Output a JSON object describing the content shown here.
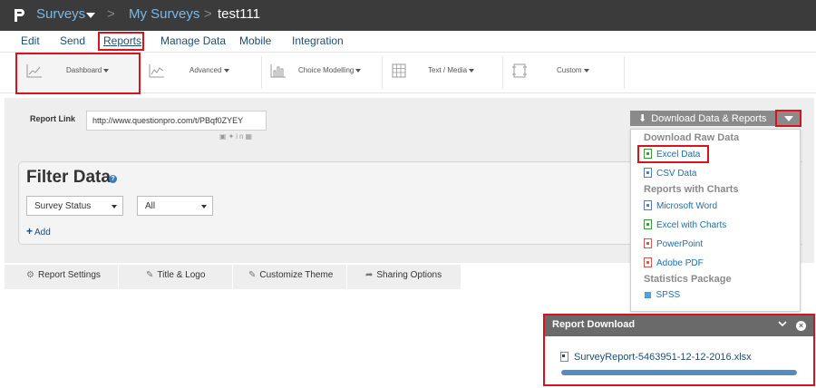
{
  "topbar": {
    "surveys_label": "Surveys",
    "separator": ">",
    "my_surveys_label": "My Surveys",
    "current_survey": "test111"
  },
  "main_nav": {
    "items": [
      "Edit",
      "Send",
      "Reports",
      "Manage Data",
      "Mobile",
      "Integration"
    ],
    "active": "Reports"
  },
  "sub_nav": {
    "items": [
      {
        "label": "Dashboard",
        "icon": "line-chart-icon"
      },
      {
        "label": "Advanced",
        "icon": "scatter-chart-icon"
      },
      {
        "label": "Choice Modelling",
        "icon": "bar-chart-icon"
      },
      {
        "label": "Text / Media",
        "icon": "grid-icon"
      },
      {
        "label": "Custom",
        "icon": "custom-report-icon"
      }
    ],
    "active": "Dashboard"
  },
  "report_link": {
    "label": "Report Link",
    "value": "http://www.questionpro.com/t/PBqf0ZYEY",
    "social_icons": [
      "facebook-icon",
      "twitter-icon",
      "linkedin-icon",
      "qr-code-icon"
    ]
  },
  "download": {
    "button_label": "Download Data & Reports",
    "menu": {
      "raw_header": "Download Raw Data",
      "excel_data": "Excel Data",
      "csv_data": "CSV Data",
      "charts_header": "Reports with Charts",
      "word": "Microsoft Word",
      "excel_charts": "Excel with Charts",
      "powerpoint": "PowerPoint",
      "pdf": "Adobe PDF",
      "stats_header": "Statistics Package",
      "spss": "SPSS"
    }
  },
  "filter": {
    "title": "Filter Data",
    "status_select": "Survey Status",
    "value_select": "All",
    "add_label": "Add"
  },
  "tabs": {
    "report_settings": "Report Settings",
    "title_logo": "Title & Logo",
    "customize_theme": "Customize Theme",
    "sharing_options": "Sharing Options"
  },
  "report_download": {
    "title": "Report Download",
    "filename": "SurveyReport-5463951-12-12-2016.xlsx",
    "progress": 1.0
  },
  "colors": {
    "topbar_bg": "#3b3b3b",
    "link_blue": "#1a4d7a",
    "highlight_red": "#d9121b",
    "button_gray": "#8a8a8a"
  }
}
